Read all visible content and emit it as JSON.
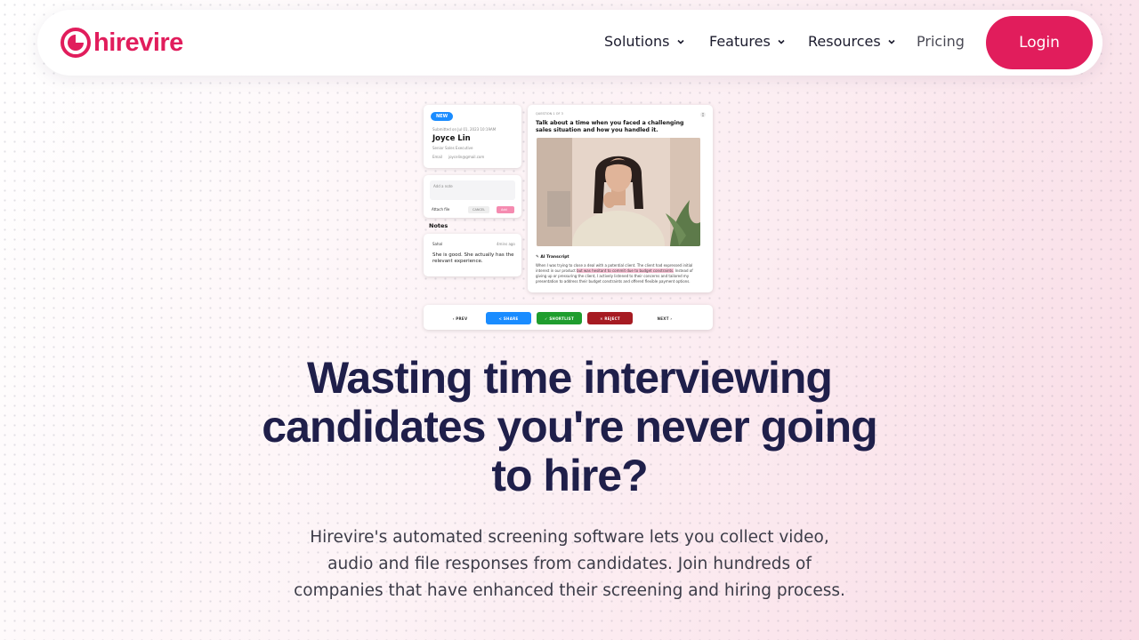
{
  "brand": {
    "name": "hirevire",
    "color": "#e11d5c"
  },
  "nav": {
    "items": [
      {
        "label": "Solutions",
        "has_dropdown": true
      },
      {
        "label": "Features",
        "has_dropdown": true
      },
      {
        "label": "Resources",
        "has_dropdown": true
      },
      {
        "label": "Pricing",
        "has_dropdown": false
      }
    ],
    "login_label": "Login"
  },
  "mockup": {
    "candidate": {
      "badge": "NEW",
      "submitted": "Submitted on Jul 01, 2023 10:19AM",
      "name": "Joyce Lin",
      "role": "Senior Sales Executive",
      "email_label": "Email",
      "email": "joycelin@gmail.com"
    },
    "note_box": {
      "placeholder": "Add a note",
      "attach": "Attach file",
      "cancel": "CANCEL",
      "add": "Add"
    },
    "notes": {
      "heading": "Notes",
      "author": "Sahal",
      "time": "4mins ago",
      "text": "She is good. She actually has the relevant experience."
    },
    "question": {
      "counter": "QUESTION 1 OF 3",
      "title": "Talk about a time when you faced a challenging sales situation and how you handled it.",
      "transcript_heading": "AI Transcript",
      "transcript_before": "When I was trying to close a deal with a potential client. The client had expressed initial interest in our product ",
      "transcript_highlight": "but was hesitant to commit due to budget constraints.",
      "transcript_after": " Instead of giving up or pressuring the client, I actively listened to their concerns and tailored my presentation to address their budget constraints and offered flexible payment options."
    },
    "actions": {
      "prev": "PREV",
      "share": "SHARE",
      "shortlist": "SHORTLIST",
      "reject": "REJECT",
      "next": "NEXT"
    }
  },
  "hero": {
    "title": "Wasting time interviewing candidates you're never going to hire?",
    "subtitle": "Hirevire's automated screening software lets you collect video, audio and file responses from candidates. Join hundreds of companies that have enhanced their screening and hiring process."
  },
  "colors": {
    "accent": "#e11d5c",
    "heading": "#1f1f4a",
    "share": "#1a8cff",
    "shortlist": "#1f9d2e",
    "reject": "#a61b22"
  }
}
